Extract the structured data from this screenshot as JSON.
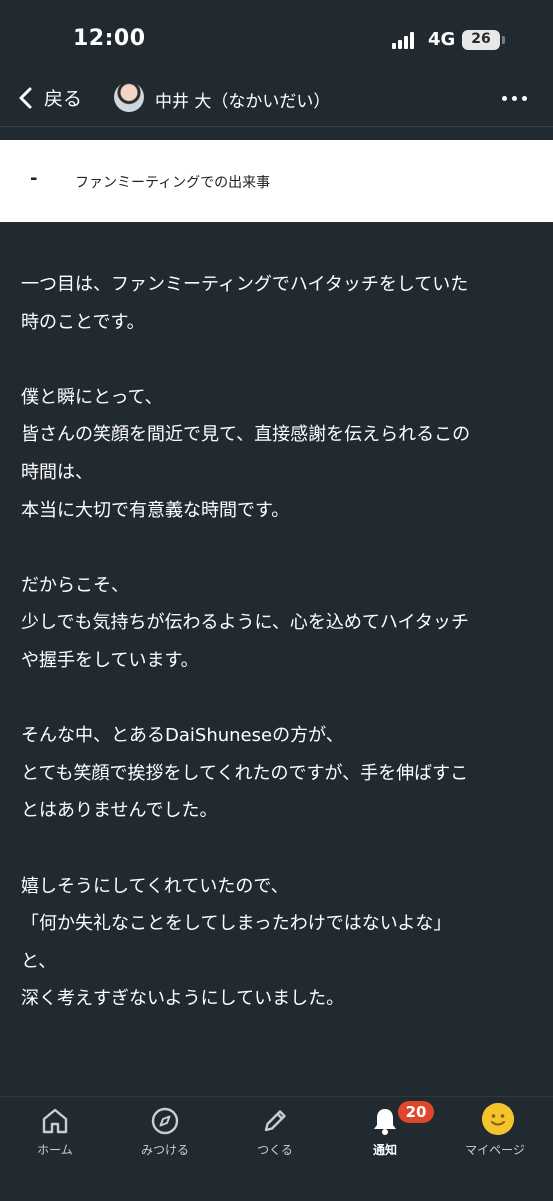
{
  "status": {
    "time": "12:00",
    "network": "4G",
    "battery": "26"
  },
  "header": {
    "back_label": "戻る",
    "author_name": "中井 大（なかいだい）"
  },
  "section": {
    "dash": "-",
    "title": "ファンミーティングでの出来事"
  },
  "article": {
    "paragraphs": [
      [
        "一つ目は、ファンミーティングでハイタッチをしていた",
        "時のことです。"
      ],
      [
        "僕と瞬にとって、",
        "皆さんの笑顔を間近で見て、直接感謝を伝えられるこの",
        "時間は、",
        "本当に大切で有意義な時間です。"
      ],
      [
        "だからこそ、",
        "少しでも気持ちが伝わるように、心を込めてハイタッチ",
        "や握手をしています。"
      ],
      [
        "そんな中、とあるDaiShuneseの方が、",
        "とても笑顔で挨拶をしてくれたのですが、手を伸ばすこ",
        "とはありませんでした。"
      ],
      [
        "嬉しそうにしてくれていたので、",
        "「何か失礼なことをしてしまったわけではないよな」",
        "と、",
        "深く考えすぎないようにしていました。"
      ]
    ]
  },
  "tabbar": {
    "home": "ホーム",
    "discover": "みつける",
    "create": "つくる",
    "notifications": "通知",
    "notifications_badge": "20",
    "mypage": "マイページ"
  }
}
